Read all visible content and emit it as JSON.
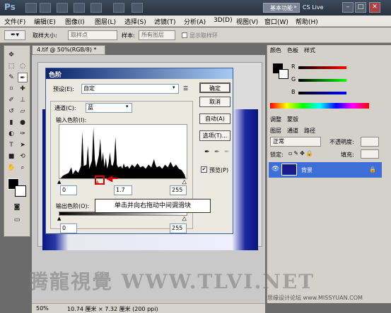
{
  "titlebar": {
    "app_logo": "Ps",
    "essentials_label": "基本功能",
    "cslive_label": "CS Live",
    "minimize": "–",
    "restore": "□",
    "close": "✕"
  },
  "menubar": {
    "items": [
      "文件(F)",
      "编辑(E)",
      "图像(I)",
      "图层(L)",
      "选择(S)",
      "滤镜(T)",
      "分析(A)",
      "3D(D)",
      "视图(V)",
      "窗口(W)",
      "帮助(H)"
    ]
  },
  "options": {
    "sample_size_label": "取样大小:",
    "sample_size_value": "取样点",
    "sample_label": "样本:",
    "sample_value": "所有图层",
    "show_ring_label": "显示取样环"
  },
  "document": {
    "tab_label": "4.tif @ 50%(RGB/8) *",
    "zoom": "50%",
    "doc_size": "10.74 厘米 × 7.32 厘米 (200 ppi)"
  },
  "levels_dialog": {
    "title": "色阶",
    "preset_label": "预设(E):",
    "preset_value": "自定",
    "channel_label": "通道(C):",
    "channel_value": "蓝",
    "input_levels_label": "输入色阶(I):",
    "input_black": "0",
    "input_mid": "1.7",
    "input_white": "255",
    "output_levels_label": "输出色阶(O):",
    "output_black": "0",
    "output_white": "255",
    "ok_label": "确定",
    "cancel_label": "取消",
    "auto_label": "自动(A)",
    "options_label": "选项(T)...",
    "preview_label": "预览(P)",
    "preview_checked": true
  },
  "callout": {
    "text": "单击并向右拖动中间调滑块"
  },
  "panels": {
    "color_tabs": [
      "颜色",
      "色板",
      "样式"
    ],
    "adjust_tabs": [
      "调整",
      "蒙版"
    ],
    "layer_tabs": [
      "图层",
      "通道",
      "路径"
    ],
    "blend_mode": "正常",
    "opacity_label": "不透明度:",
    "lock_label": "锁定:",
    "fill_label": "填充:",
    "layer_name": "背景",
    "channel_letters": [
      "R",
      "G",
      "B"
    ]
  },
  "watermark": {
    "main": "腾龍視覺 WWW.TLVI.NET",
    "sub": "思缘设计论坛 www.MISSYUAN.COM"
  },
  "colors": {
    "accent_red": "#e00000",
    "title_blue": "#0a246a",
    "layer_highlight": "#3d6fd6"
  }
}
